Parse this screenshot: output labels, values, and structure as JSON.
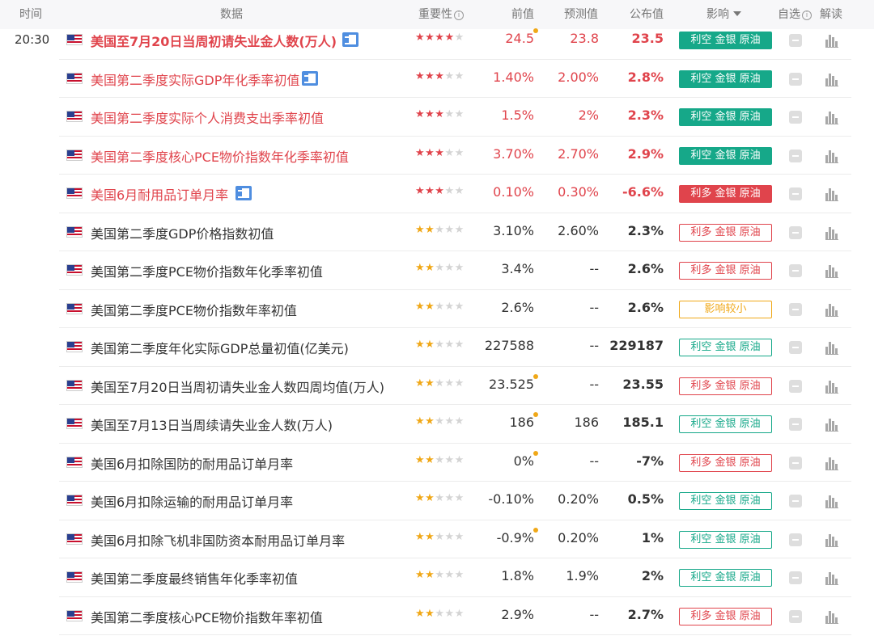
{
  "header": {
    "time": "时间",
    "data": "数据",
    "importance": "重要性",
    "previous": "前值",
    "forecast": "预测值",
    "actual": "公布值",
    "impact": "影响",
    "watch": "自选",
    "analysis": "解读",
    "info_icon": "i"
  },
  "colors": {
    "red": "#e0444c",
    "green": "#16a889",
    "orange": "#f0a818",
    "header_bg": "#f7f7f9"
  },
  "rows": [
    {
      "time": "20:30",
      "name": "美国至7月20日当周初请失业金人数(万人)",
      "name_style": "red-bold",
      "doc_icon": true,
      "stars": 4,
      "star_color": "red",
      "previous": "24.5",
      "prev_dot": true,
      "forecast": "23.8",
      "actual": "23.5",
      "actual_color": "red",
      "impact": "利空 金银 原油",
      "impact_style": "kong-solid"
    },
    {
      "time": "",
      "name": "美国第二季度实际GDP年化季率初值",
      "name_style": "red",
      "doc_icon": true,
      "stars": 3,
      "star_color": "red",
      "previous": "1.40%",
      "prev_dot": false,
      "forecast": "2.00%",
      "actual": "2.8%",
      "actual_color": "red",
      "impact": "利空 金银 原油",
      "impact_style": "kong-solid"
    },
    {
      "time": "",
      "name": "美国第二季度实际个人消费支出季率初值",
      "name_style": "red",
      "doc_icon": false,
      "stars": 3,
      "star_color": "red",
      "previous": "1.5%",
      "prev_dot": false,
      "forecast": "2%",
      "actual": "2.3%",
      "actual_color": "red",
      "impact": "利空 金银 原油",
      "impact_style": "kong-solid"
    },
    {
      "time": "",
      "name": "美国第二季度核心PCE物价指数年化季率初值",
      "name_style": "red",
      "doc_icon": false,
      "stars": 3,
      "star_color": "red",
      "previous": "3.70%",
      "prev_dot": false,
      "forecast": "2.70%",
      "actual": "2.9%",
      "actual_color": "red",
      "impact": "利空 金银 原油",
      "impact_style": "kong-solid"
    },
    {
      "time": "",
      "name": "美国6月耐用品订单月率",
      "name_style": "red",
      "doc_icon": true,
      "stars": 3,
      "star_color": "red",
      "previous": "0.10%",
      "prev_dot": false,
      "forecast": "0.30%",
      "actual": "-6.6%",
      "actual_color": "red",
      "impact": "利多 金银 原油",
      "impact_style": "duo-solid"
    },
    {
      "time": "",
      "name": "美国第二季度GDP价格指数初值",
      "name_style": "normal",
      "doc_icon": false,
      "stars": 2,
      "star_color": "orange",
      "previous": "3.10%",
      "prev_dot": false,
      "forecast": "2.60%",
      "actual": "2.3%",
      "actual_color": "dark",
      "impact": "利多 金银 原油",
      "impact_style": "duo-outline"
    },
    {
      "time": "",
      "name": "美国第二季度PCE物价指数年化季率初值",
      "name_style": "normal",
      "doc_icon": false,
      "stars": 2,
      "star_color": "orange",
      "previous": "3.4%",
      "prev_dot": false,
      "forecast": "--",
      "actual": "2.6%",
      "actual_color": "dark",
      "impact": "利多 金银 原油",
      "impact_style": "duo-outline"
    },
    {
      "time": "",
      "name": "美国第二季度PCE物价指数年率初值",
      "name_style": "normal",
      "doc_icon": false,
      "stars": 2,
      "star_color": "orange",
      "previous": "2.6%",
      "prev_dot": false,
      "forecast": "--",
      "actual": "2.6%",
      "actual_color": "dark",
      "impact": "影响较小",
      "impact_style": "small-outline"
    },
    {
      "time": "",
      "name": "美国第二季度年化实际GDP总量初值(亿美元)",
      "name_style": "normal",
      "doc_icon": false,
      "stars": 2,
      "star_color": "orange",
      "previous": "227588",
      "prev_dot": false,
      "forecast": "--",
      "actual": "229187",
      "actual_color": "dark",
      "impact": "利空 金银 原油",
      "impact_style": "kong-outline"
    },
    {
      "time": "",
      "name": "美国至7月20日当周初请失业金人数四周均值(万人)",
      "name_style": "normal",
      "doc_icon": false,
      "stars": 2,
      "star_color": "orange",
      "previous": "23.525",
      "prev_dot": true,
      "forecast": "--",
      "actual": "23.55",
      "actual_color": "dark",
      "impact": "利多 金银 原油",
      "impact_style": "duo-outline"
    },
    {
      "time": "",
      "name": "美国至7月13日当周续请失业金人数(万人)",
      "name_style": "normal",
      "doc_icon": false,
      "stars": 2,
      "star_color": "orange",
      "previous": "186",
      "prev_dot": true,
      "forecast": "186",
      "actual": "185.1",
      "actual_color": "dark",
      "impact": "利空 金银 原油",
      "impact_style": "kong-outline"
    },
    {
      "time": "",
      "name": "美国6月扣除国防的耐用品订单月率",
      "name_style": "normal",
      "doc_icon": false,
      "stars": 2,
      "star_color": "orange",
      "previous": "0%",
      "prev_dot": true,
      "forecast": "--",
      "actual": "-7%",
      "actual_color": "dark",
      "impact": "利多 金银 原油",
      "impact_style": "duo-outline"
    },
    {
      "time": "",
      "name": "美国6月扣除运输的耐用品订单月率",
      "name_style": "normal",
      "doc_icon": false,
      "stars": 2,
      "star_color": "orange",
      "previous": "-0.10%",
      "prev_dot": false,
      "forecast": "0.20%",
      "actual": "0.5%",
      "actual_color": "dark",
      "impact": "利空 金银 原油",
      "impact_style": "kong-outline"
    },
    {
      "time": "",
      "name": "美国6月扣除飞机非国防资本耐用品订单月率",
      "name_style": "normal",
      "doc_icon": false,
      "stars": 2,
      "star_color": "orange",
      "previous": "-0.9%",
      "prev_dot": true,
      "forecast": "0.20%",
      "actual": "1%",
      "actual_color": "dark",
      "impact": "利空 金银 原油",
      "impact_style": "kong-outline"
    },
    {
      "time": "",
      "name": "美国第二季度最终销售年化季率初值",
      "name_style": "normal",
      "doc_icon": false,
      "stars": 2,
      "star_color": "orange",
      "previous": "1.8%",
      "prev_dot": false,
      "forecast": "1.9%",
      "actual": "2%",
      "actual_color": "dark",
      "impact": "利空 金银 原油",
      "impact_style": "kong-outline"
    },
    {
      "time": "",
      "name": "美国第二季度核心PCE物价指数年率初值",
      "name_style": "normal",
      "doc_icon": false,
      "stars": 2,
      "star_color": "orange",
      "previous": "2.9%",
      "prev_dot": false,
      "forecast": "--",
      "actual": "2.7%",
      "actual_color": "dark",
      "impact": "利多 金银 原油",
      "impact_style": "duo-outline"
    }
  ]
}
